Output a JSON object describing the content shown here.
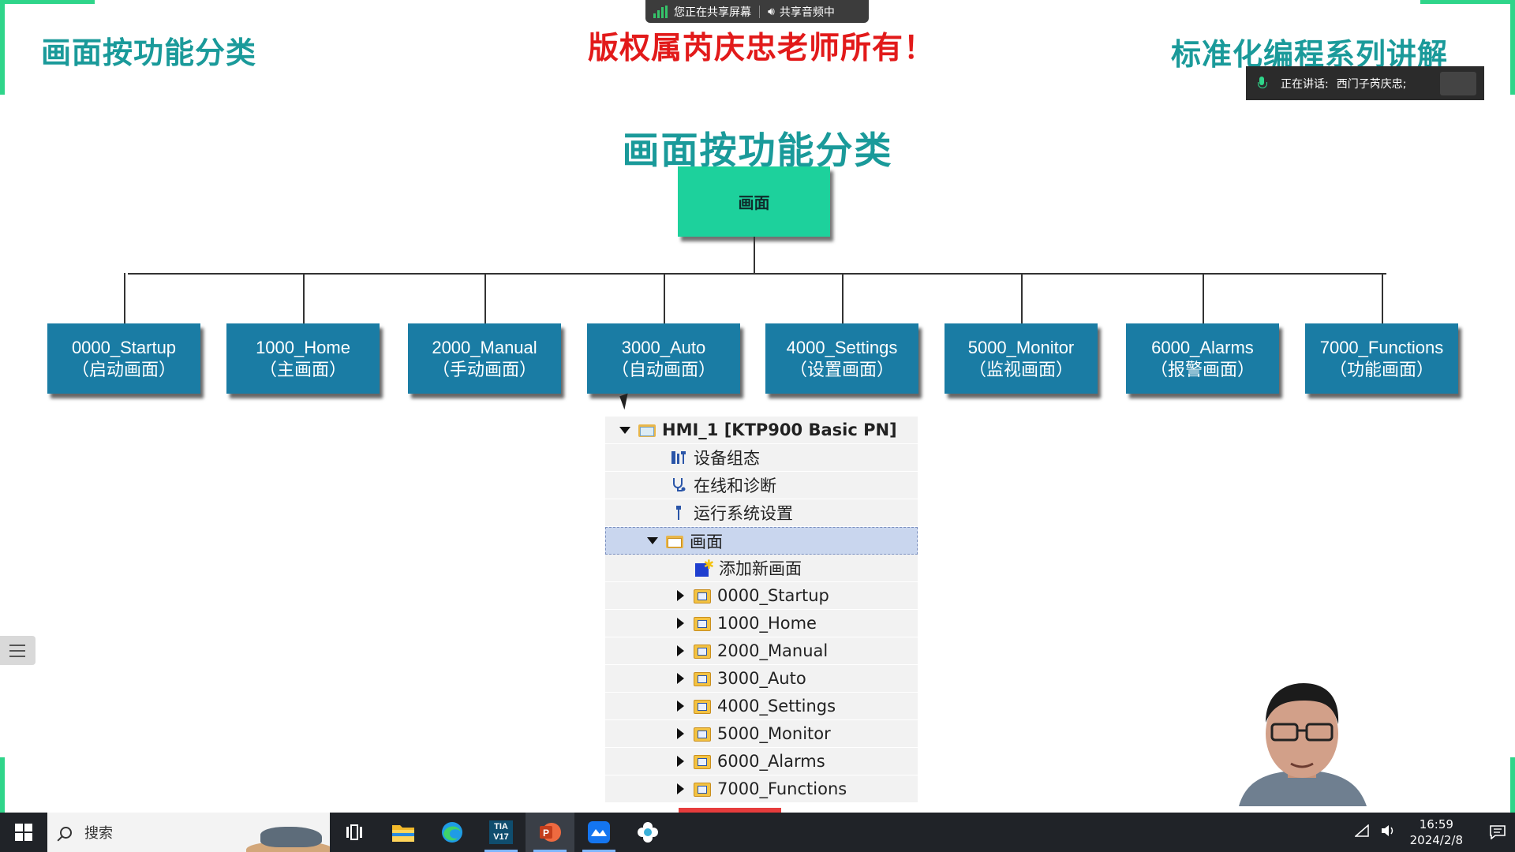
{
  "slide": {
    "header_left": "画面按功能分类",
    "header_center": "版权属芮庆忠老师所有！",
    "header_right": "标准化编程系列讲解",
    "title": "画面按功能分类",
    "root_label": "画面",
    "nodes": [
      {
        "name": "0000_Startup",
        "sub": "（启动画面）"
      },
      {
        "name": "1000_Home",
        "sub": "（主画面）"
      },
      {
        "name": "2000_Manual",
        "sub": "（手动画面）"
      },
      {
        "name": "3000_Auto",
        "sub": "（自动画面）"
      },
      {
        "name": "4000_Settings",
        "sub": "（设置画面）"
      },
      {
        "name": "5000_Monitor",
        "sub": "（监视画面）"
      },
      {
        "name": "6000_Alarms",
        "sub": "（报警画面）"
      },
      {
        "name": "7000_Functions",
        "sub": "（功能画面）"
      }
    ],
    "tree": {
      "device": "HMI_1 [KTP900 Basic PN]",
      "items": [
        "设备组态",
        "在线和诊断",
        "运行系统设置"
      ],
      "screens_folder": "画面",
      "add_screen": "添加新画面",
      "screens": [
        "0000_Startup",
        "1000_Home",
        "2000_Manual",
        "3000_Auto",
        "4000_Settings",
        "5000_Monitor",
        "6000_Alarms",
        "7000_Functions"
      ]
    }
  },
  "meeting": {
    "sharing_screen": "您正在共享屏幕",
    "sharing_audio": "共享音频中",
    "speaking_label": "正在讲话:",
    "speaker": "西门子芮庆忠;"
  },
  "taskbar": {
    "search_placeholder": "搜索",
    "apps": [
      "task-view",
      "file-explorer",
      "edge",
      "tia-portal-v17",
      "powerpoint",
      "lark",
      "settings-app"
    ],
    "tia_label": "TIA V17",
    "time": "16:59",
    "date": "2024/2/8"
  },
  "colors": {
    "accent_teal": "#1a9a9a",
    "copyright_red": "#e21a1a",
    "root_green": "#1dd19c",
    "node_blue": "#1a7ca4",
    "corner_green": "#2fd58a"
  }
}
